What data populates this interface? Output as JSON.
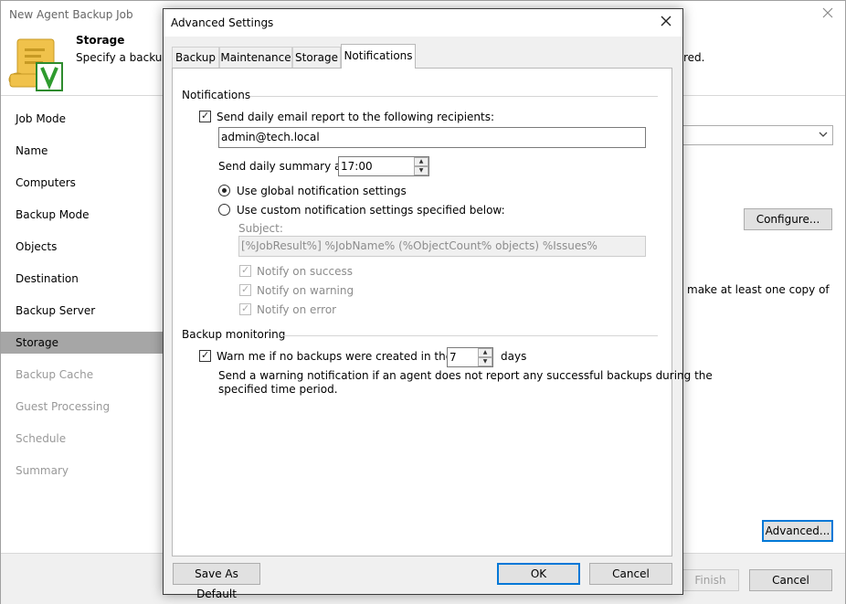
{
  "wizard": {
    "title": "New Agent Backup Job",
    "step_title": "Storage",
    "step_desc_left": "Specify a backup r",
    "step_desc_right": "red.",
    "sidebar": [
      {
        "label": "Job Mode",
        "state": "normal"
      },
      {
        "label": "Name",
        "state": "normal"
      },
      {
        "label": "Computers",
        "state": "normal"
      },
      {
        "label": "Backup Mode",
        "state": "normal"
      },
      {
        "label": "Objects",
        "state": "normal"
      },
      {
        "label": "Destination",
        "state": "normal"
      },
      {
        "label": "Backup Server",
        "state": "normal"
      },
      {
        "label": "Storage",
        "state": "selected"
      },
      {
        "label": "Backup Cache",
        "state": "disabled"
      },
      {
        "label": "Guest Processing",
        "state": "disabled"
      },
      {
        "label": "Schedule",
        "state": "disabled"
      },
      {
        "label": "Summary",
        "state": "disabled"
      }
    ],
    "configure_label": "Configure...",
    "copy_text": "make at least one copy of",
    "advanced_label": "Advanced...",
    "finish_label": "Finish",
    "cancel_label": "Cancel"
  },
  "dialog": {
    "title": "Advanced Settings",
    "tabs": [
      "Backup",
      "Maintenance",
      "Storage",
      "Notifications"
    ],
    "active_tab": "Notifications",
    "notifications_group": "Notifications",
    "send_email_label": "Send daily email report to the following recipients:",
    "send_email_checked": true,
    "recipients_value": "admin@tech.local",
    "summary_label": "Send daily summary at:",
    "summary_time": "17:00",
    "use_global_label": "Use global notification settings",
    "use_custom_label": "Use custom notification settings specified below:",
    "selected_option": "global",
    "subject_label": "Subject:",
    "subject_value": "[%JobResult%] %JobName% (%ObjectCount% objects) %Issues%",
    "notify_success_label": "Notify on success",
    "notify_warning_label": "Notify on warning",
    "notify_error_label": "Notify on error",
    "monitoring_group": "Backup monitoring",
    "warn_label": "Warn me if no backups were created in the last",
    "warn_checked": true,
    "warn_days_value": "7",
    "days_label": "days",
    "warn_desc_line1": "Send a warning notification if an agent does not report any successful backups during the",
    "warn_desc_line2": "specified time period.",
    "save_default_label": "Save As Default",
    "ok_label": "OK",
    "cancel_label": "Cancel"
  },
  "colors": {
    "focus_border": "#0078d7",
    "selected_sidebar": "#a6a6a6",
    "dialog_bg": "#f0f0f0"
  }
}
